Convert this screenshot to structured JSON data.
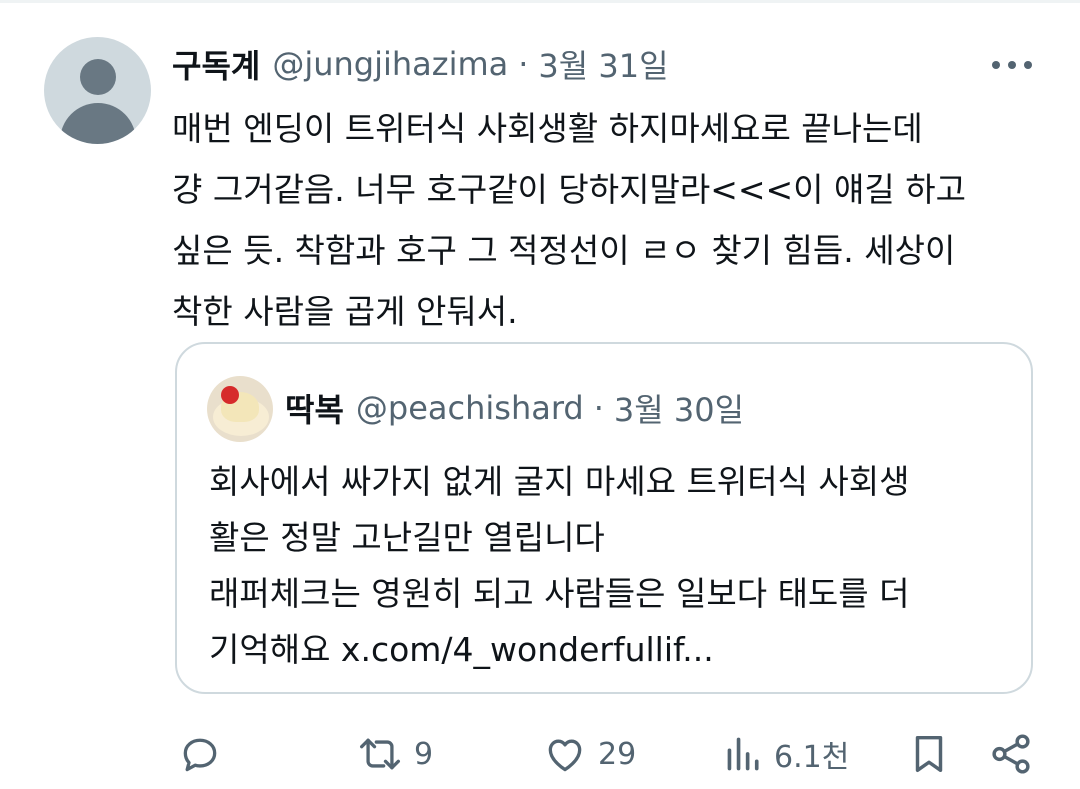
{
  "tweet": {
    "author_name": "구독계",
    "handle": "@jungjihazima",
    "separator": "·",
    "date": "3월 31일",
    "lines": [
      "매번 엔딩이 트위터식 사회생활 하지마세요로 끝나는데",
      "걍 그거같음. 너무 호구같이 당하지말라<<<이 얘길 하고",
      "싶은 듯. 착함과 호구 그 적정선이 ㄹㅇ 찾기 힘듬. 세상이",
      "착한 사람을 곱게 안둬서."
    ],
    "more_icon": "more-horizontal-icon"
  },
  "quote": {
    "author_name": "딱복",
    "handle": "@peachishard",
    "separator": "·",
    "date": "3월 30일",
    "lines": [
      "회사에서 싸가지 없게 굴지 마세요 트위터식 사회생",
      "활은 정말 고난길만 열립니다",
      "래퍼체크는 영원히 되고 사람들은 일보다 태도를 더",
      "기억해요 x.com/4_wonderfullif..."
    ]
  },
  "actions": {
    "reply": {
      "icon": "reply-icon",
      "count": ""
    },
    "repost": {
      "icon": "repost-icon",
      "count": "9"
    },
    "like": {
      "icon": "heart-icon",
      "count": "29"
    },
    "views": {
      "icon": "views-icon",
      "count": "6.1천"
    },
    "bookmark": {
      "icon": "bookmark-icon"
    },
    "share": {
      "icon": "share-icon"
    }
  },
  "colors": {
    "text": "#0f1419",
    "secondary": "#536471",
    "border": "#cfd9de"
  }
}
